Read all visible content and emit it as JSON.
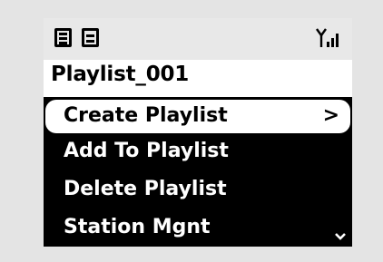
{
  "header": {
    "icons": [
      "list-view-icon",
      "split-view-icon",
      "signal-strength-icon"
    ]
  },
  "title": "Playlist_001",
  "menu": {
    "items": [
      {
        "label": "Create Playlist",
        "selected": true,
        "submenu_glyph": ">"
      },
      {
        "label": "Add To Playlist"
      },
      {
        "label": "Delete Playlist"
      },
      {
        "label": "Station Mgnt"
      }
    ],
    "more_indicator": "chevron-down-icon"
  },
  "colors": {
    "screen_background": "#000000",
    "selection_background": "#ffffff",
    "status_bar_background": "#e8e8e8",
    "outer_background": "#e4e4e4"
  }
}
